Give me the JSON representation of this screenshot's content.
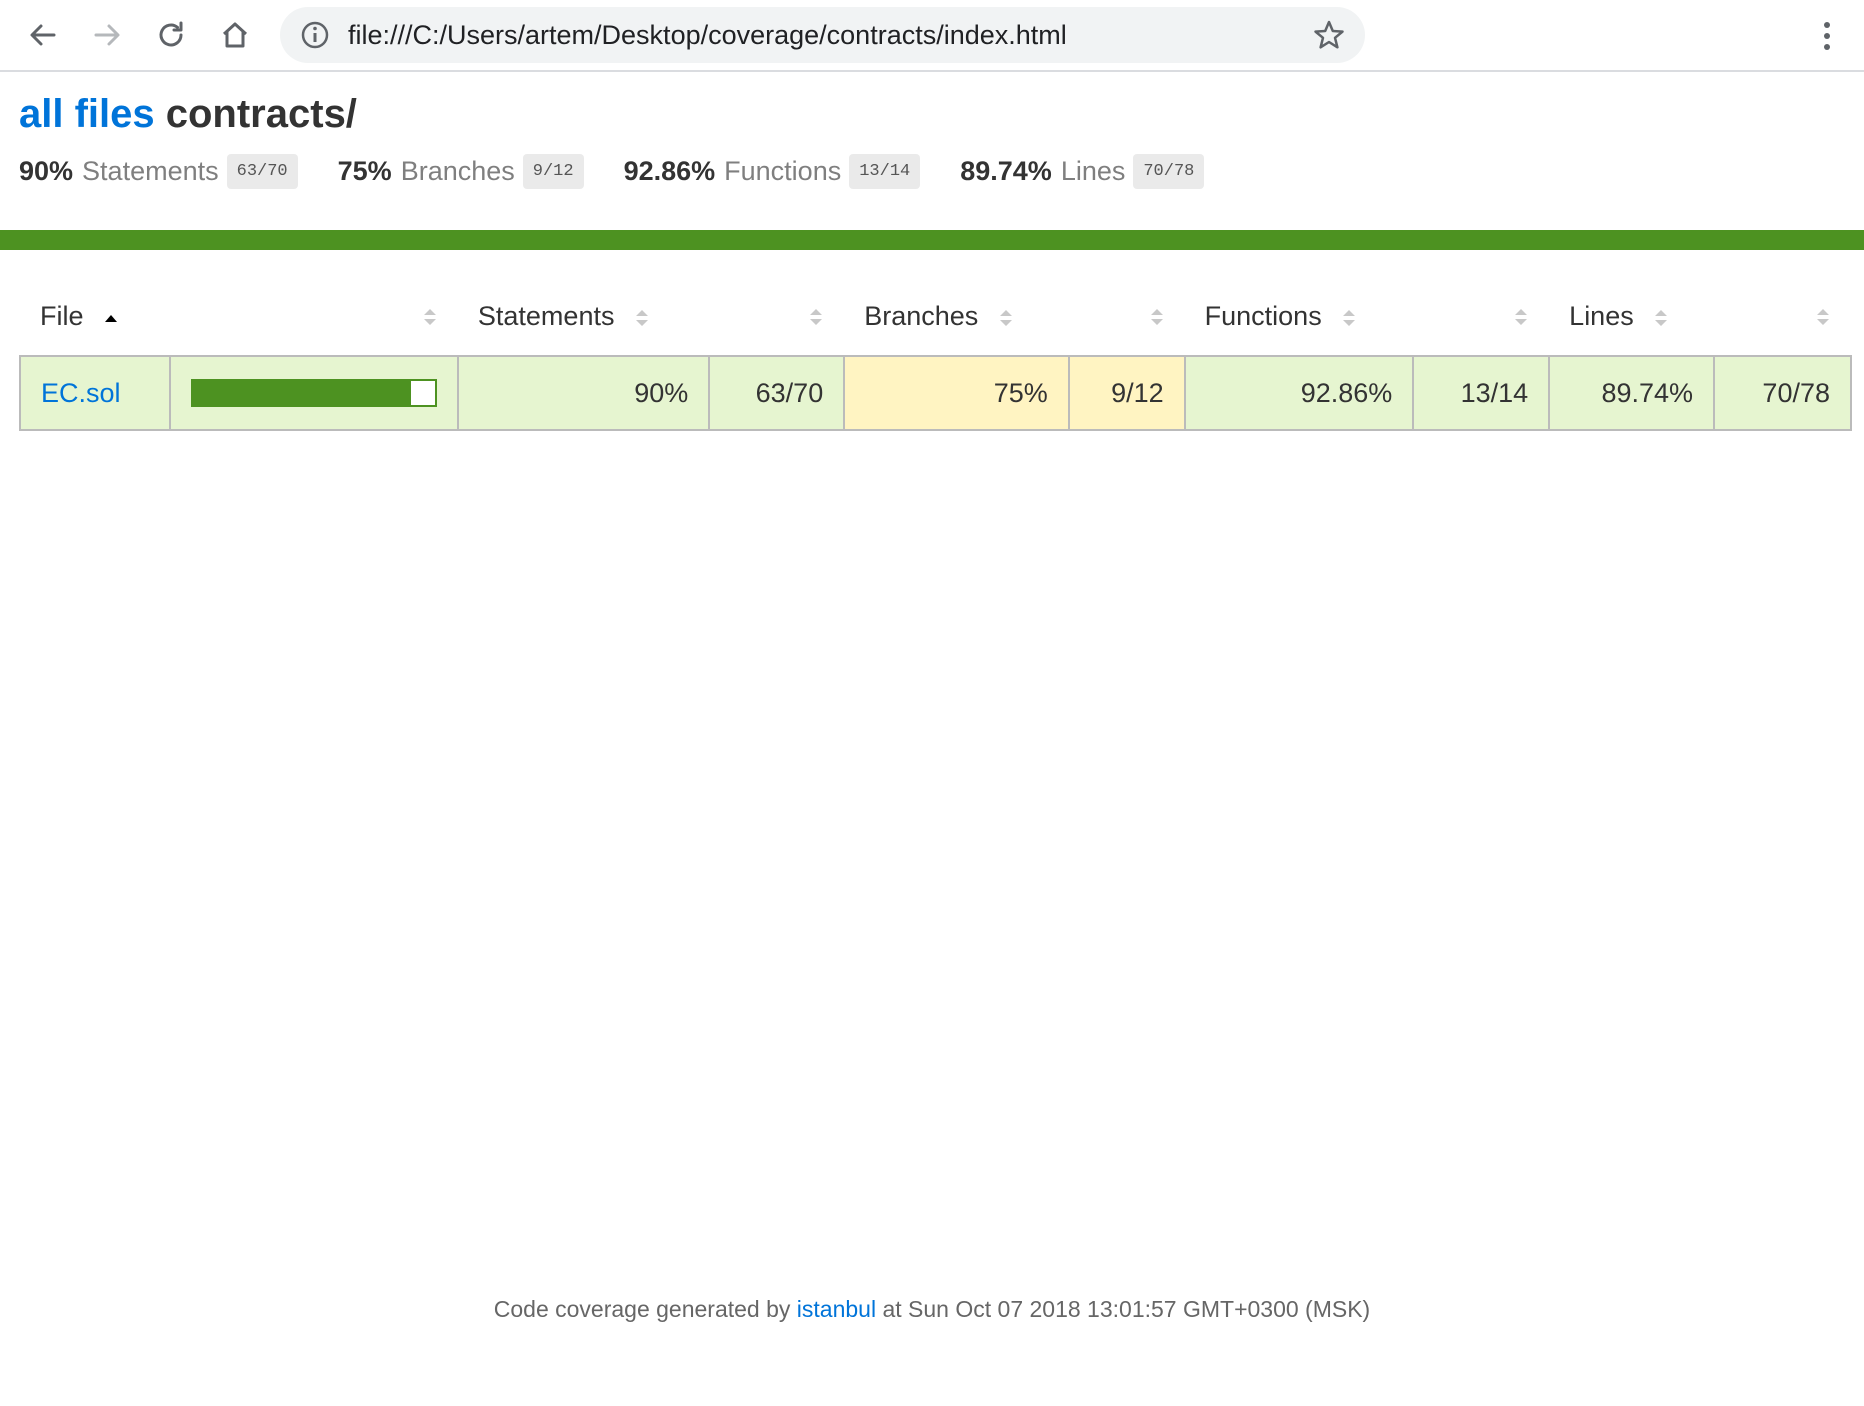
{
  "browser": {
    "url": "file:///C:/Users/artem/Desktop/coverage/contracts/index.html",
    "icons": {
      "back": "arrow-left-icon",
      "forward": "arrow-right-icon",
      "reload": "reload-icon",
      "home": "home-icon",
      "info": "info-icon",
      "star": "star-icon",
      "menu": "vertical-dots-icon"
    }
  },
  "header": {
    "all_files_link": "all files",
    "directory": "contracts/"
  },
  "summary": [
    {
      "pct": "90%",
      "label": "Statements",
      "fraction": "63/70"
    },
    {
      "pct": "75%",
      "label": "Branches",
      "fraction": "9/12"
    },
    {
      "pct": "92.86%",
      "label": "Functions",
      "fraction": "13/14"
    },
    {
      "pct": "89.74%",
      "label": "Lines",
      "fraction": "70/78"
    }
  ],
  "colors": {
    "high": "#4d9221",
    "high_bg": "#e6f5d0",
    "medium_bg": "#fff4c2",
    "link": "#0074D9"
  },
  "table": {
    "columns": [
      "File",
      "Statements",
      "Branches",
      "Functions",
      "Lines"
    ],
    "sort_column": "File",
    "sort_direction": "ascending",
    "rows": [
      {
        "file": "EC.sol",
        "coverage_fraction": 0.9,
        "statements_pct": "90%",
        "statements_abs": "63/70",
        "branches_pct": "75%",
        "branches_abs": "9/12",
        "functions_pct": "92.86%",
        "functions_abs": "13/14",
        "lines_pct": "89.74%",
        "lines_abs": "70/78"
      }
    ]
  },
  "footer": {
    "prefix": "Code coverage generated by",
    "link": "istanbul",
    "suffix": "at Sun Oct 07 2018 13:01:57 GMT+0300 (MSK)"
  }
}
